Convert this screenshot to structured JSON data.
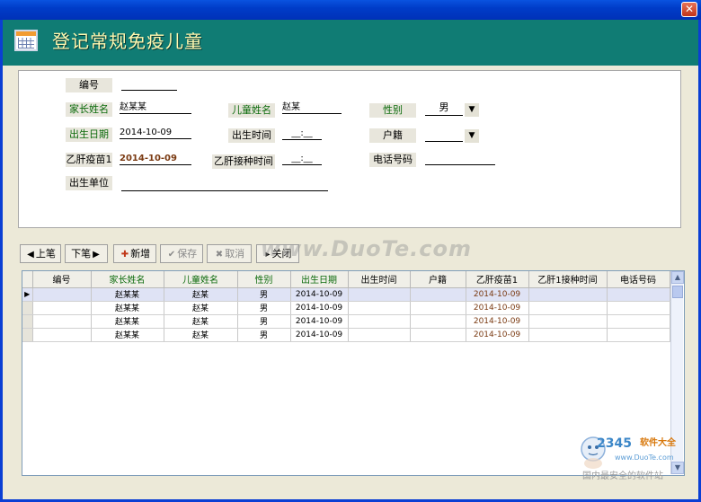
{
  "window": {
    "close_glyph": "✕",
    "title_icon": "table-icon"
  },
  "header": {
    "title": "登记常规免疫儿童"
  },
  "form": {
    "labels": {
      "id": "编号",
      "parent_name": "家长姓名",
      "child_name": "儿童姓名",
      "gender": "性别",
      "birth_date": "出生日期",
      "birth_time": "出生时间",
      "household": "户籍",
      "hepb1": "乙肝疫苗1",
      "hepb_time": "乙肝接种时间",
      "phone": "电话号码",
      "birth_place": "出生单位"
    },
    "values": {
      "id": "",
      "parent_name": "赵某某",
      "child_name": "赵某",
      "gender": "男",
      "birth_date": "2014-10-09",
      "birth_time": "__:__",
      "household": "",
      "hepb1": "2014-10-09",
      "hepb_time": "__:__",
      "phone": "",
      "birth_place": ""
    }
  },
  "toolbar": {
    "prev": "上笔",
    "next": "下笔",
    "add": "新增",
    "save": "保存",
    "cancel": "取消",
    "close": "关闭"
  },
  "watermark": "www.DuoTe.com",
  "grid": {
    "columns": [
      "编号",
      "家长姓名",
      "儿童姓名",
      "性别",
      "出生日期",
      "出生时间",
      "户籍",
      "乙肝疫苗1",
      "乙肝1接种时间",
      "电话号码"
    ],
    "rows": [
      [
        "",
        "赵某某",
        "赵某",
        "男",
        "2014-10-09",
        "",
        "",
        "2014-10-09",
        "",
        ""
      ],
      [
        "",
        "赵某某",
        "赵某",
        "男",
        "2014-10-09",
        "",
        "",
        "2014-10-09",
        "",
        ""
      ],
      [
        "",
        "赵某某",
        "赵某",
        "男",
        "2014-10-09",
        "",
        "",
        "2014-10-09",
        "",
        ""
      ],
      [
        "",
        "赵某某",
        "赵某",
        "男",
        "2014-10-09",
        "",
        "",
        "2014-10-09",
        "",
        ""
      ]
    ]
  },
  "brand": {
    "number": "2345",
    "name": "软件大全",
    "url": "www.DuoTe.com",
    "slogan": "国内最安全的软件站"
  },
  "colors": {
    "header_bg": "#107c74",
    "title_text": "#fff8b0",
    "label_green": "#0a6a0a",
    "date_brown": "#7a3a12"
  }
}
